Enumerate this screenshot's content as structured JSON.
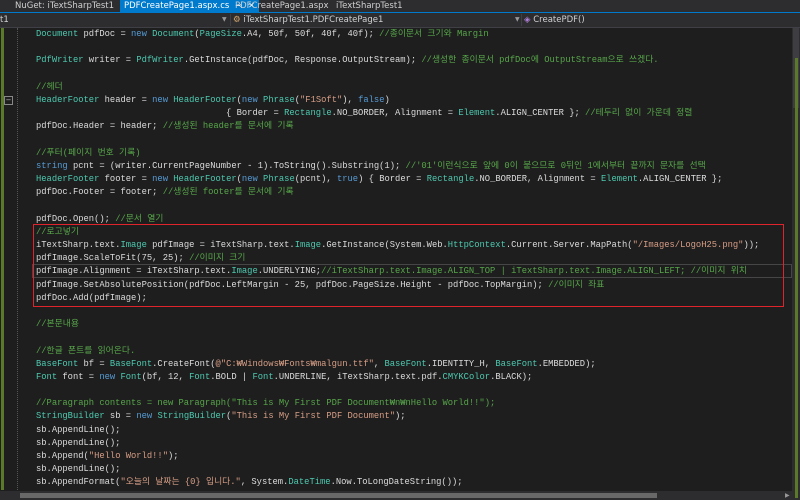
{
  "tabs": [
    {
      "label": "NuGet: iTextSharpTest1",
      "active": false
    },
    {
      "label": "PDFCreatePage1.aspx.cs",
      "active": true
    },
    {
      "label": "PDFCreatePage1.aspx",
      "active": false
    },
    {
      "label": "iTextSharpTest1",
      "active": false
    }
  ],
  "tab_icons": {
    "pin": "⊸",
    "close": "✕"
  },
  "navbar": {
    "project": "t1",
    "class": "iTextSharpTest1.PDFCreatePage1",
    "member": "CreatePDF()"
  },
  "colors": {
    "accent": "#007acc",
    "keyword": "#569cd6",
    "type": "#4ec9b0",
    "comment": "#57a64a",
    "string": "#d69d85",
    "highlight_box": "#e0242b"
  },
  "code_lines": [
    [
      [
        "t",
        "Document"
      ],
      [
        "p",
        " pdfDoc = "
      ],
      [
        "k",
        "new"
      ],
      [
        "p",
        " "
      ],
      [
        "t",
        "Document"
      ],
      [
        "p",
        "("
      ],
      [
        "t",
        "PageSize"
      ],
      [
        "p",
        ".A4, 50f, 50f, 40f, 40f); "
      ],
      [
        "c",
        "//종이문서 크기와 Margin"
      ]
    ],
    [],
    [
      [
        "t",
        "PdfWriter"
      ],
      [
        "p",
        " writer = "
      ],
      [
        "t",
        "PdfWriter"
      ],
      [
        "p",
        ".GetInstance(pdfDoc, Response.OutputStream); "
      ],
      [
        "c",
        "//생성한 종이문서 pdfDoc에 OutputStream으로 쓰겠다."
      ]
    ],
    [],
    [
      [
        "c",
        "//헤더"
      ]
    ],
    [
      [
        "t",
        "HeaderFooter"
      ],
      [
        "p",
        " header = "
      ],
      [
        "k",
        "new"
      ],
      [
        "p",
        " "
      ],
      [
        "t",
        "HeaderFooter"
      ],
      [
        "p",
        "("
      ],
      [
        "k",
        "new"
      ],
      [
        "p",
        " "
      ],
      [
        "t",
        "Phrase"
      ],
      [
        "p",
        "("
      ],
      [
        "s",
        "\"F1Soft\""
      ],
      [
        "p",
        "), "
      ],
      [
        "k",
        "false"
      ],
      [
        "p",
        ")"
      ]
    ],
    [
      [
        "p",
        "                                    { Border = "
      ],
      [
        "t",
        "Rectangle"
      ],
      [
        "p",
        ".NO_BORDER, Alignment = "
      ],
      [
        "t",
        "Element"
      ],
      [
        "p",
        ".ALIGN_CENTER }; "
      ],
      [
        "c",
        "//테두리 없이 가운데 정렬"
      ]
    ],
    [
      [
        "p",
        "pdfDoc.Header = header; "
      ],
      [
        "c",
        "//생성된 header를 문서에 기록"
      ]
    ],
    [],
    [
      [
        "c",
        "//푸터(페이지 번호 기록)"
      ]
    ],
    [
      [
        "k",
        "string"
      ],
      [
        "p",
        " pcnt = (writer.CurrentPageNumber - 1).ToString().Substring(1); "
      ],
      [
        "c",
        "//'01'이런식으로 앞에 0이 붙으므로 0뒤인 1에서부터 끝까지 문자를 선택"
      ]
    ],
    [
      [
        "t",
        "HeaderFooter"
      ],
      [
        "p",
        " footer = "
      ],
      [
        "k",
        "new"
      ],
      [
        "p",
        " "
      ],
      [
        "t",
        "HeaderFooter"
      ],
      [
        "p",
        "("
      ],
      [
        "k",
        "new"
      ],
      [
        "p",
        " "
      ],
      [
        "t",
        "Phrase"
      ],
      [
        "p",
        "(pcnt), "
      ],
      [
        "k",
        "true"
      ],
      [
        "p",
        ") { Border = "
      ],
      [
        "t",
        "Rectangle"
      ],
      [
        "p",
        ".NO_BORDER, Alignment = "
      ],
      [
        "t",
        "Element"
      ],
      [
        "p",
        ".ALIGN_CENTER };"
      ]
    ],
    [
      [
        "p",
        "pdfDoc.Footer = footer; "
      ],
      [
        "c",
        "//생성된 footer를 문서에 기록"
      ]
    ],
    [],
    [
      [
        "p",
        "pdfDoc.Open(); "
      ],
      [
        "c",
        "//문서 열기"
      ]
    ],
    [
      [
        "c",
        "//로고넣기"
      ]
    ],
    [
      [
        "p",
        "iTextSharp.text."
      ],
      [
        "t",
        "Image"
      ],
      [
        "p",
        " pdfImage = iTextSharp.text."
      ],
      [
        "t",
        "Image"
      ],
      [
        "p",
        ".GetInstance(System.Web."
      ],
      [
        "t",
        "HttpContext"
      ],
      [
        "p",
        ".Current.Server.MapPath("
      ],
      [
        "s",
        "\"/Images/LogoH25.png\""
      ],
      [
        "p",
        "));"
      ]
    ],
    [
      [
        "p",
        "pdfImage.ScaleToFit(75, 25); "
      ],
      [
        "c",
        "//이미지 크기"
      ]
    ],
    [
      [
        "p",
        "pdfImage.Alignment = iTextSharp.text."
      ],
      [
        "t",
        "Image"
      ],
      [
        "p",
        ".UNDERLYING;"
      ],
      [
        "c",
        "//iTextSharp.text.Image.ALIGN_TOP | iTextSharp.text.Image.ALIGN_LEFT; //이미지 위치"
      ]
    ],
    [
      [
        "p",
        "pdfImage.SetAbsolutePosition(pdfDoc.LeftMargin - 25, pdfDoc.PageSize.Height - pdfDoc.TopMargin); "
      ],
      [
        "c",
        "//이미지 좌표"
      ]
    ],
    [
      [
        "p",
        "pdfDoc.Add(pdfImage);"
      ]
    ],
    [],
    [
      [
        "c",
        "//본문내용"
      ]
    ],
    [],
    [
      [
        "c",
        "//한글 폰트를 읽어온다."
      ]
    ],
    [
      [
        "t",
        "BaseFont"
      ],
      [
        "p",
        " bf = "
      ],
      [
        "t",
        "BaseFont"
      ],
      [
        "p",
        ".CreateFont("
      ],
      [
        "s",
        "@\"C:₩Windows₩Fonts₩malgun.ttf\""
      ],
      [
        "p",
        ", "
      ],
      [
        "t",
        "BaseFont"
      ],
      [
        "p",
        ".IDENTITY_H, "
      ],
      [
        "t",
        "BaseFont"
      ],
      [
        "p",
        ".EMBEDDED);"
      ]
    ],
    [
      [
        "t",
        "Font"
      ],
      [
        "p",
        " font = "
      ],
      [
        "k",
        "new"
      ],
      [
        "p",
        " "
      ],
      [
        "t",
        "Font"
      ],
      [
        "p",
        "(bf, 12, "
      ],
      [
        "t",
        "Font"
      ],
      [
        "p",
        ".BOLD | "
      ],
      [
        "t",
        "Font"
      ],
      [
        "p",
        ".UNDERLINE, iTextSharp.text.pdf."
      ],
      [
        "t",
        "CMYKColor"
      ],
      [
        "p",
        ".BLACK);"
      ]
    ],
    [],
    [
      [
        "c",
        "//Paragraph contents = new Paragraph(\"This is My First PDF Document₩n₩nHello World!!\");"
      ]
    ],
    [
      [
        "t",
        "StringBuilder"
      ],
      [
        "p",
        " sb = "
      ],
      [
        "k",
        "new"
      ],
      [
        "p",
        " "
      ],
      [
        "t",
        "StringBuilder"
      ],
      [
        "p",
        "("
      ],
      [
        "s",
        "\"This is My First PDF Document\""
      ],
      [
        "p",
        ");"
      ]
    ],
    [
      [
        "p",
        "sb.AppendLine();"
      ]
    ],
    [
      [
        "p",
        "sb.AppendLine();"
      ]
    ],
    [
      [
        "p",
        "sb.Append("
      ],
      [
        "s",
        "\"Hello World!!\""
      ],
      [
        "p",
        ");"
      ]
    ],
    [
      [
        "p",
        "sb.AppendLine();"
      ]
    ],
    [
      [
        "p",
        "sb.AppendFormat("
      ],
      [
        "s",
        "\"오늘의 날짜는 {0} 입니다.\""
      ],
      [
        "p",
        ", System."
      ],
      [
        "t",
        "DateTime"
      ],
      [
        "p",
        ".Now.ToLongDateString());"
      ]
    ]
  ]
}
